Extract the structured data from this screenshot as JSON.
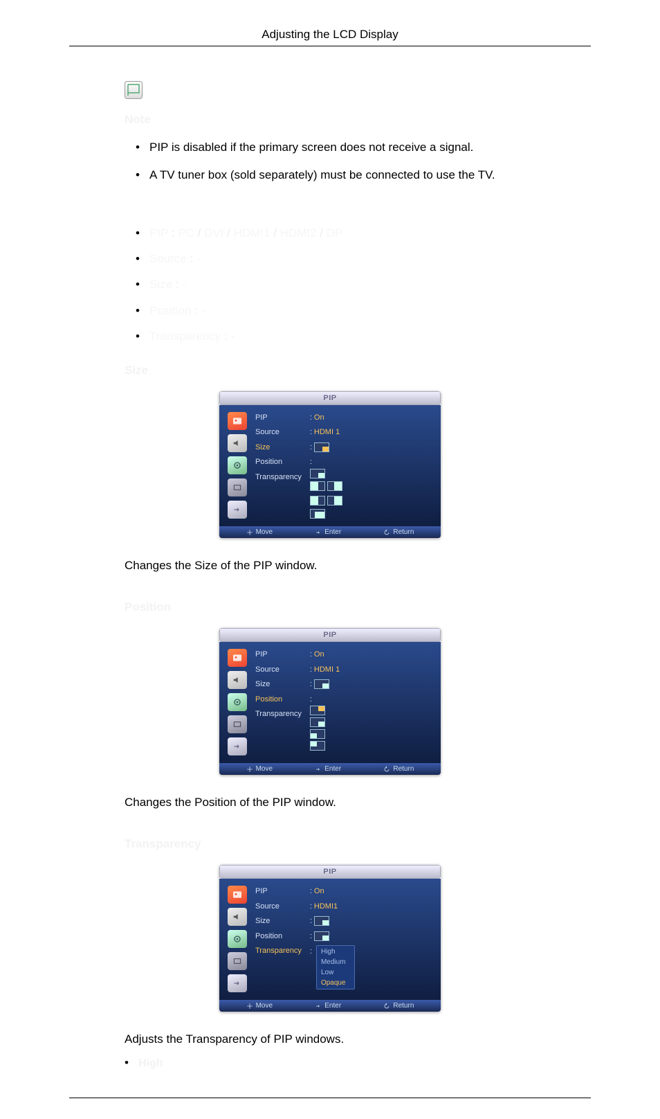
{
  "header": {
    "title": "Adjusting the LCD Display"
  },
  "notes": {
    "heading": "Note",
    "items": [
      "PIP is disabled if the primary screen does not receive a signal.",
      "A TV tuner box (sold separately) must be connected to use the TV."
    ]
  },
  "ghost_lines": [
    "PIP : PC / DVI / HDMI1 / HDMI2 / DP",
    "Source : -",
    "Size : -",
    "Position : -",
    "Transparency : -"
  ],
  "sections": {
    "size": {
      "title": "Size",
      "desc": "Changes the Size of the PIP window.",
      "osd": {
        "title": "PIP",
        "labels": [
          "PIP",
          "Source",
          "Size",
          "Position",
          "Transparency"
        ],
        "highlight": "Size",
        "values": {
          "PIP": "On",
          "Source": "HDMI 1"
        },
        "footer": {
          "move": "Move",
          "enter": "Enter",
          "return": "Return"
        }
      }
    },
    "position": {
      "title": "Position",
      "desc": "Changes the Position of the PIP window.",
      "osd": {
        "title": "PIP",
        "labels": [
          "PIP",
          "Source",
          "Size",
          "Position",
          "Transparency"
        ],
        "highlight": "Position",
        "values": {
          "PIP": "On",
          "Source": "HDMI 1"
        },
        "footer": {
          "move": "Move",
          "enter": "Enter",
          "return": "Return"
        }
      }
    },
    "transparency": {
      "title": "Transparency",
      "desc": "Adjusts the Transparency of PIP windows.",
      "osd": {
        "title": "PIP",
        "labels": [
          "PIP",
          "Source",
          "Size",
          "Position",
          "Transparency"
        ],
        "highlight": "Transparency",
        "values": {
          "PIP": "On",
          "Source": "HDMI1"
        },
        "dropdown": [
          "High",
          "Medium",
          "Low",
          "Opaque"
        ],
        "dropdown_selected": "Opaque",
        "footer": {
          "move": "Move",
          "enter": "Enter",
          "return": "Return"
        }
      },
      "final_item": "High"
    }
  }
}
